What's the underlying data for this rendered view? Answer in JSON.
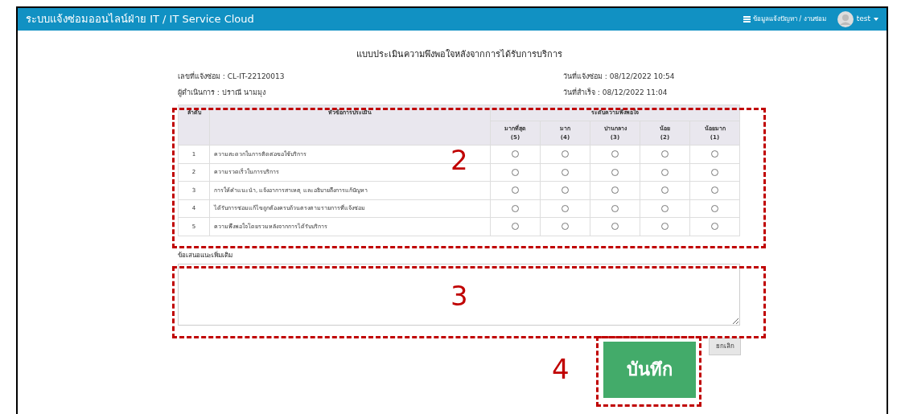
{
  "header": {
    "title": "ระบบแจ้งซ่อมออนไลน์ฝ่าย IT / IT Service Cloud",
    "nav_link": "ข้อมูลแจ้งปัญหา / งานซ่อม",
    "user": "test"
  },
  "form": {
    "title": "แบบประเมินความพึงพอใจหลังจากการได้รับการบริการ",
    "info": [
      {
        "label": "เลขที่แจ้งซ่อม : CL-IT-22120013"
      },
      {
        "label": "วันที่แจ้งซ่อม : 08/12/2022 10:54"
      },
      {
        "label": "ผู้ดำเนินการ : ปราณี นามมุง"
      },
      {
        "label": "วันที่สำเร็จ : 08/12/2022 11:04"
      }
    ],
    "table": {
      "columns": [
        "ลำดับ",
        "หัวข้อการประเมิน"
      ],
      "group_header": "ระดับความพึงพอใจ",
      "levels": [
        {
          "label": "มากที่สุด",
          "score": "(5)"
        },
        {
          "label": "มาก",
          "score": "(4)"
        },
        {
          "label": "ปานกลาง",
          "score": "(3)"
        },
        {
          "label": "น้อย",
          "score": "(2)"
        },
        {
          "label": "น้อยมาก",
          "score": "(1)"
        }
      ],
      "rows": [
        {
          "no": "1",
          "topic": "ความสะดวกในการติดต่อขอใช้บริการ",
          "options": [
            {
              "selected": false
            },
            {
              "selected": false
            },
            {
              "selected": false
            },
            {
              "selected": false
            },
            {
              "selected": false
            }
          ]
        },
        {
          "no": "2",
          "topic": "ความรวดเร็วในการบริการ",
          "options": [
            {
              "selected": false
            },
            {
              "selected": false
            },
            {
              "selected": false
            },
            {
              "selected": false
            },
            {
              "selected": false
            }
          ]
        },
        {
          "no": "3",
          "topic": "การให้คำแนะนำ, แจ้งอาการสาเหตุ และอธิบายถึงการแก้ปัญหา",
          "options": [
            {
              "selected": false
            },
            {
              "selected": false
            },
            {
              "selected": false
            },
            {
              "selected": false
            },
            {
              "selected": false
            }
          ]
        },
        {
          "no": "4",
          "topic": "ได้รับการซ่อมแก้ไขถูกต้องครบถ้วนตรงตามรายการที่แจ้งซ่อม",
          "options": [
            {
              "selected": false
            },
            {
              "selected": false
            },
            {
              "selected": false
            },
            {
              "selected": false
            },
            {
              "selected": false
            }
          ]
        },
        {
          "no": "5",
          "topic": "ความพึงพอใจโดยรวมหลังจากการได้รับบริการ",
          "options": [
            {
              "selected": false
            },
            {
              "selected": false
            },
            {
              "selected": false
            },
            {
              "selected": false
            },
            {
              "selected": false
            }
          ]
        }
      ]
    },
    "comment_label": "ข้อเสนอแนะเพิ่มเติม",
    "buttons": {
      "save": "บันทึก",
      "cancel": "ยกเลิก"
    }
  },
  "annotations": [
    {
      "label": "2"
    },
    {
      "label": "3"
    },
    {
      "label": "4"
    }
  ]
}
